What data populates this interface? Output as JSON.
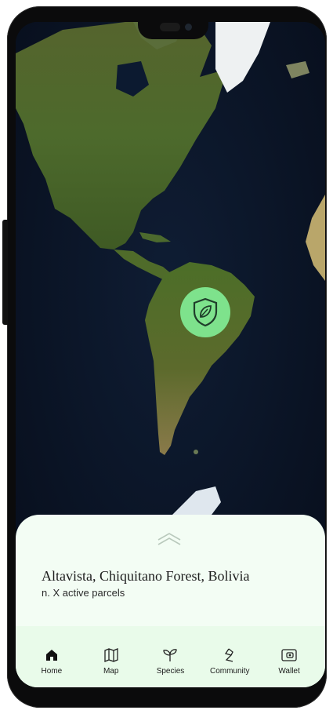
{
  "map": {
    "marker_icon": "shield-leaf-icon",
    "marker_color": "#7ee28c"
  },
  "sheet": {
    "expand_icon": "chevron-up-double-icon",
    "location_title": "Altavista, Chiquitano Forest, Bolivia",
    "location_subtitle": "n. X active parcels"
  },
  "nav": [
    {
      "label": "Home",
      "icon": "home-icon",
      "active": true
    },
    {
      "label": "Map",
      "icon": "map-icon",
      "active": false
    },
    {
      "label": "Species",
      "icon": "sprout-icon",
      "active": false
    },
    {
      "label": "Community",
      "icon": "community-icon",
      "active": false
    },
    {
      "label": "Wallet",
      "icon": "wallet-icon",
      "active": false
    }
  ],
  "colors": {
    "sheet_bg": "#f3fdf4",
    "nav_bg": "#e9fbea",
    "accent": "#7ee28c",
    "text": "#1c1c1c"
  }
}
